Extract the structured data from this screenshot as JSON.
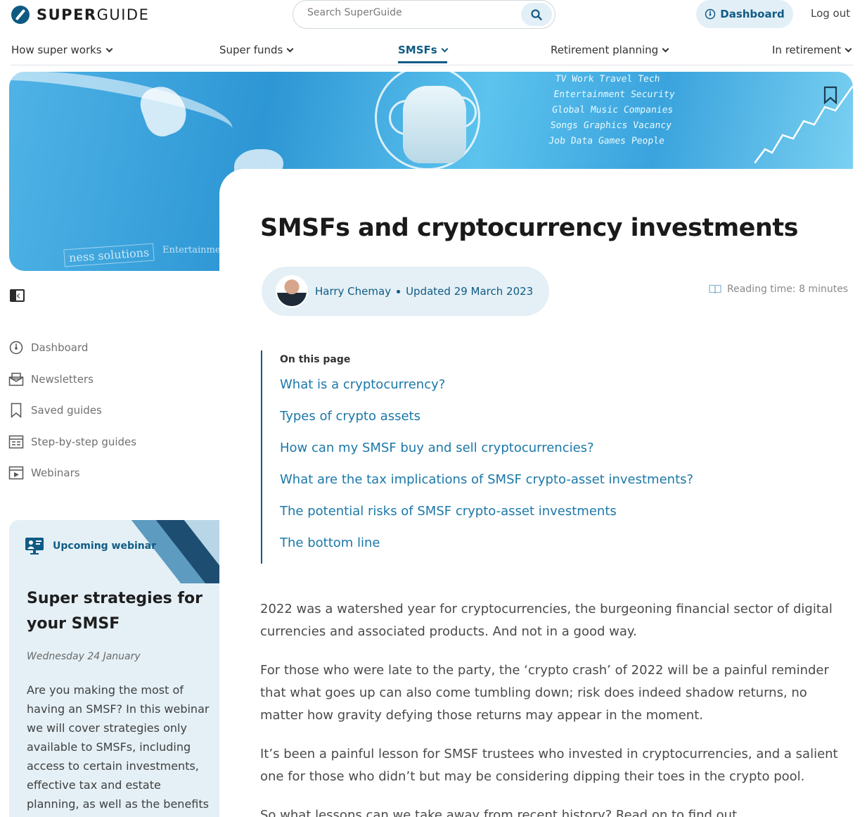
{
  "header": {
    "logo_bold": "SUPER",
    "logo_light": "GUIDE",
    "search_placeholder": "Search SuperGuide",
    "dashboard_label": "Dashboard",
    "logout_label": "Log out"
  },
  "nav": {
    "items": [
      {
        "label": "How super works"
      },
      {
        "label": "Super funds"
      },
      {
        "label": "SMSFs",
        "active": true
      },
      {
        "label": "Retirement planning"
      },
      {
        "label": "In retirement"
      }
    ]
  },
  "hero": {
    "words": [
      "TV Work Travel Tech",
      "Entertainment Security",
      "Global Music Companies",
      "Songs Graphics Vacancy",
      "Job Data Games People"
    ],
    "solutions": "ness solutions",
    "entertainment": "Entertainment"
  },
  "sidebar": {
    "items": [
      {
        "label": "Dashboard",
        "icon": "dashboard-icon"
      },
      {
        "label": "Newsletters",
        "icon": "newsletter-icon"
      },
      {
        "label": "Saved guides",
        "icon": "bookmark-icon"
      },
      {
        "label": "Step-by-step guides",
        "icon": "guide-icon"
      },
      {
        "label": "Webinars",
        "icon": "webinar-icon"
      }
    ]
  },
  "webinar": {
    "tag": "Upcoming webinar",
    "title": "Super strategies for your SMSF",
    "date": "Wednesday 24 January",
    "description": "Are you making the most of having an SMSF? In this webinar we will cover strategies only available to SMSFs, including access to certain investments, effective tax and estate planning, as well as the benefits of"
  },
  "article": {
    "title": "SMSFs and cryptocurrency investments",
    "author": "Harry Chemay",
    "updated": "Updated 29 March 2023",
    "reading_time": "Reading time: 8 minutes",
    "toc_label": "On this page",
    "toc": [
      "What is a cryptocurrency?",
      "Types of crypto assets",
      "How can my SMSF buy and sell cryptocurrencies?",
      "What are the tax implications of SMSF crypto-asset investments?",
      "The potential risks of SMSF crypto-asset investments",
      "The bottom line"
    ],
    "paragraphs": [
      "2022 was a watershed year for cryptocurrencies, the burgeoning financial sector of digital currencies and associated products. And not in a good way.",
      "For those who were late to the party, the ‘crypto crash’ of 2022 will be a painful reminder that what goes up can also come tumbling down; risk does indeed shadow returns, no matter how gravity defying those returns may appear in the moment.",
      "It’s been a painful lesson for SMSF trustees who invested in cryptocurrencies, and a salient one for those who didn’t but may be considering dipping their toes in the crypto pool.",
      "So what lessons can we take away from recent history? Read on to find out."
    ]
  },
  "colors": {
    "brand": "#105b84",
    "link": "#1b78a8",
    "panel": "#e4f0f6"
  }
}
